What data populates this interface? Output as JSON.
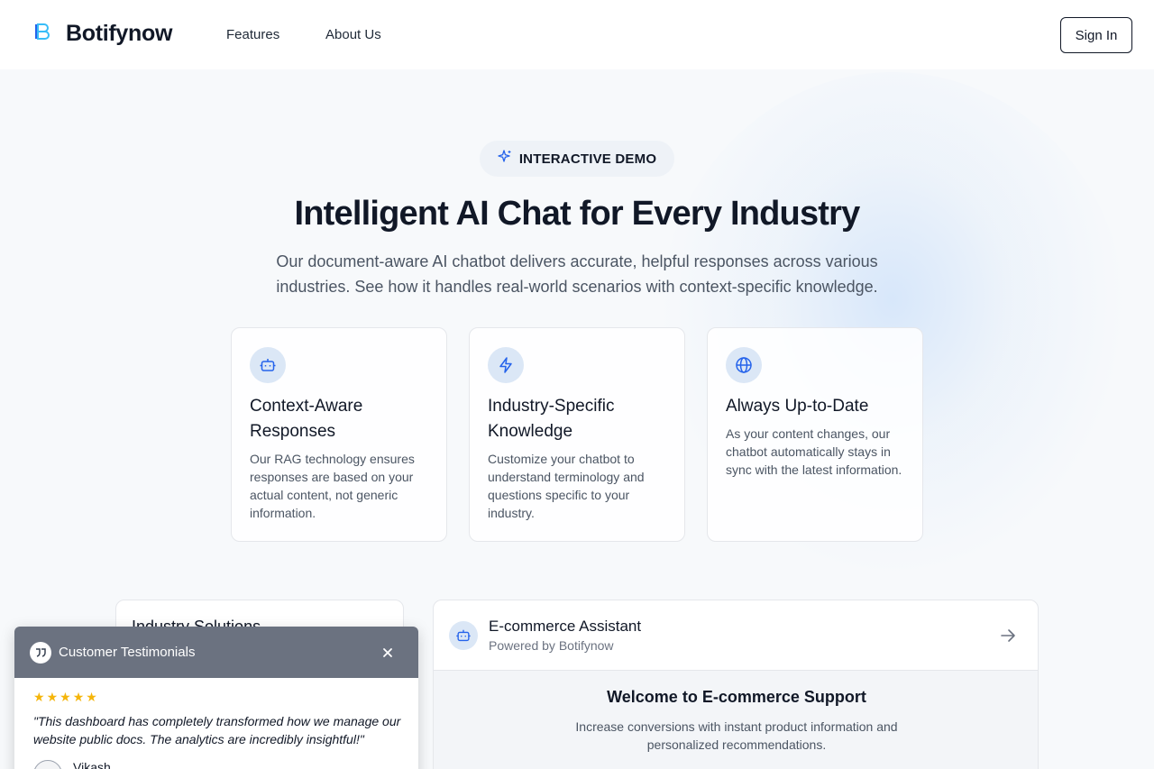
{
  "header": {
    "brand": "Botifynow",
    "logo_caption": "BOTIFYNOW",
    "nav": [
      "Features",
      "About Us"
    ],
    "sign_in": "Sign In"
  },
  "hero": {
    "badge": "INTERACTIVE DEMO",
    "title": "Intelligent AI Chat for Every Industry",
    "subtitle": "Our document-aware AI chatbot delivers accurate, helpful responses across various industries. See how it handles real-world scenarios with context-specific knowledge."
  },
  "features": [
    {
      "icon": "bot-icon",
      "title": "Context-Aware Responses",
      "description": "Our RAG technology ensures responses are based on your actual content, not generic information."
    },
    {
      "icon": "lightning-icon",
      "title": "Industry-Specific Knowledge",
      "description": "Customize your chatbot to understand terminology and questions specific to your industry."
    },
    {
      "icon": "globe-icon",
      "title": "Always Up-to-Date",
      "description": "As your content changes, our chatbot automatically stays in sync with the latest information."
    }
  ],
  "solutions": {
    "title": "Industry Solutions"
  },
  "chat": {
    "assistant_name": "E-commerce Assistant",
    "powered_by": "Powered by Botifynow",
    "welcome_title": "Welcome to E-commerce Support",
    "welcome_subtitle": "Increase conversions with instant product information and personalized recommendations."
  },
  "testimonials": {
    "title": "Customer Testimonials",
    "rating": 5,
    "quote": "\"This dashboard has completely transformed how we manage our website public docs. The analytics are incredibly insightful!\"",
    "author": "Vikash"
  },
  "colors": {
    "accent": "#2563eb",
    "icon_bg": "#dbe7f6",
    "testimonial_header": "#6b7280",
    "star": "#f5b50a"
  }
}
